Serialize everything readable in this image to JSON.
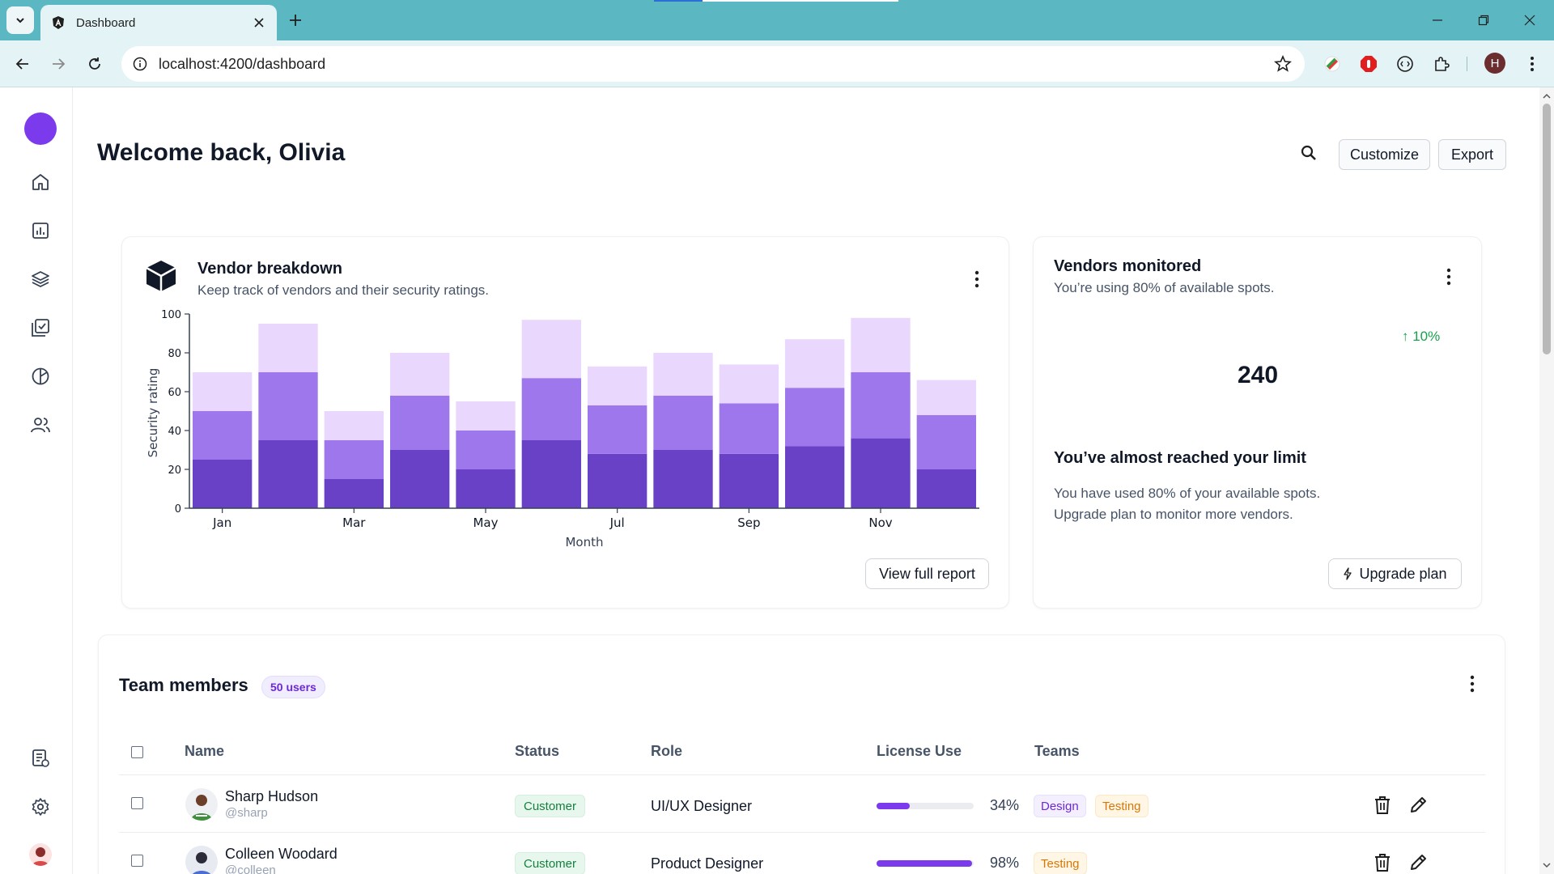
{
  "browser": {
    "tab_title": "Dashboard",
    "url": "localhost:4200/dashboard",
    "profile_initial": "H"
  },
  "sidebar": {
    "items": [
      {
        "icon": "home-icon"
      },
      {
        "icon": "bar-chart-icon"
      },
      {
        "icon": "layers-icon"
      },
      {
        "icon": "check-square-icon"
      },
      {
        "icon": "pie-chart-icon"
      },
      {
        "icon": "users-icon"
      }
    ],
    "bottom": [
      {
        "icon": "notes-icon"
      },
      {
        "icon": "settings-icon"
      },
      {
        "icon": "avatar"
      }
    ]
  },
  "header": {
    "welcome": "Welcome back, Olivia",
    "customize_label": "Customize",
    "export_label": "Export"
  },
  "vendor_card": {
    "title": "Vendor breakdown",
    "subtitle": "Keep track of vendors and their security ratings.",
    "view_report_label": "View full report"
  },
  "chart_data": {
    "type": "bar",
    "stacked": true,
    "xlabel": "Month",
    "ylabel": "Security rating",
    "ylim": [
      0,
      100
    ],
    "yticks": [
      0,
      20,
      40,
      60,
      80,
      100
    ],
    "categories": [
      "Jan",
      "Feb",
      "Mar",
      "Apr",
      "May",
      "Jun",
      "Jul",
      "Aug",
      "Sep",
      "Oct",
      "Nov",
      "Dec"
    ],
    "tick_labels_shown": [
      "Jan",
      "Mar",
      "May",
      "Jul",
      "Sep",
      "Nov"
    ],
    "colors": [
      "#6941c6",
      "#9e77ed",
      "#e9d7fe"
    ],
    "series": [
      {
        "values": [
          25,
          35,
          15,
          30,
          20,
          35,
          28,
          30,
          28,
          32,
          36,
          20
        ]
      },
      {
        "values": [
          25,
          35,
          20,
          28,
          20,
          32,
          25,
          28,
          26,
          30,
          34,
          28
        ]
      },
      {
        "values": [
          20,
          25,
          15,
          22,
          15,
          30,
          20,
          22,
          20,
          25,
          28,
          18
        ]
      }
    ]
  },
  "vendors_card": {
    "title": "Vendors monitored",
    "subtitle": "You’re using 80% of available spots.",
    "trend": "↑ 10%",
    "count": "240",
    "limit_title": "You’ve almost reached your limit",
    "limit_text_1": "You have used 80% of your available spots.",
    "limit_text_2": "Upgrade plan to monitor more vendors.",
    "upgrade_label": "Upgrade plan"
  },
  "team": {
    "title": "Team members",
    "count_badge": "50 users",
    "columns": [
      "Name",
      "Status",
      "Role",
      "License Use",
      "Teams"
    ],
    "rows": [
      {
        "name": "Sharp Hudson",
        "handle": "@sharp",
        "status": "Customer",
        "role": "UI/UX Designer",
        "license": 34,
        "license_label": "34%",
        "teams": [
          "Design",
          "Testing"
        ]
      },
      {
        "name": "Colleen Woodard",
        "handle": "@colleen",
        "status": "Customer",
        "role": "Product Designer",
        "license": 98,
        "license_label": "98%",
        "teams": [
          "Testing"
        ]
      }
    ]
  }
}
